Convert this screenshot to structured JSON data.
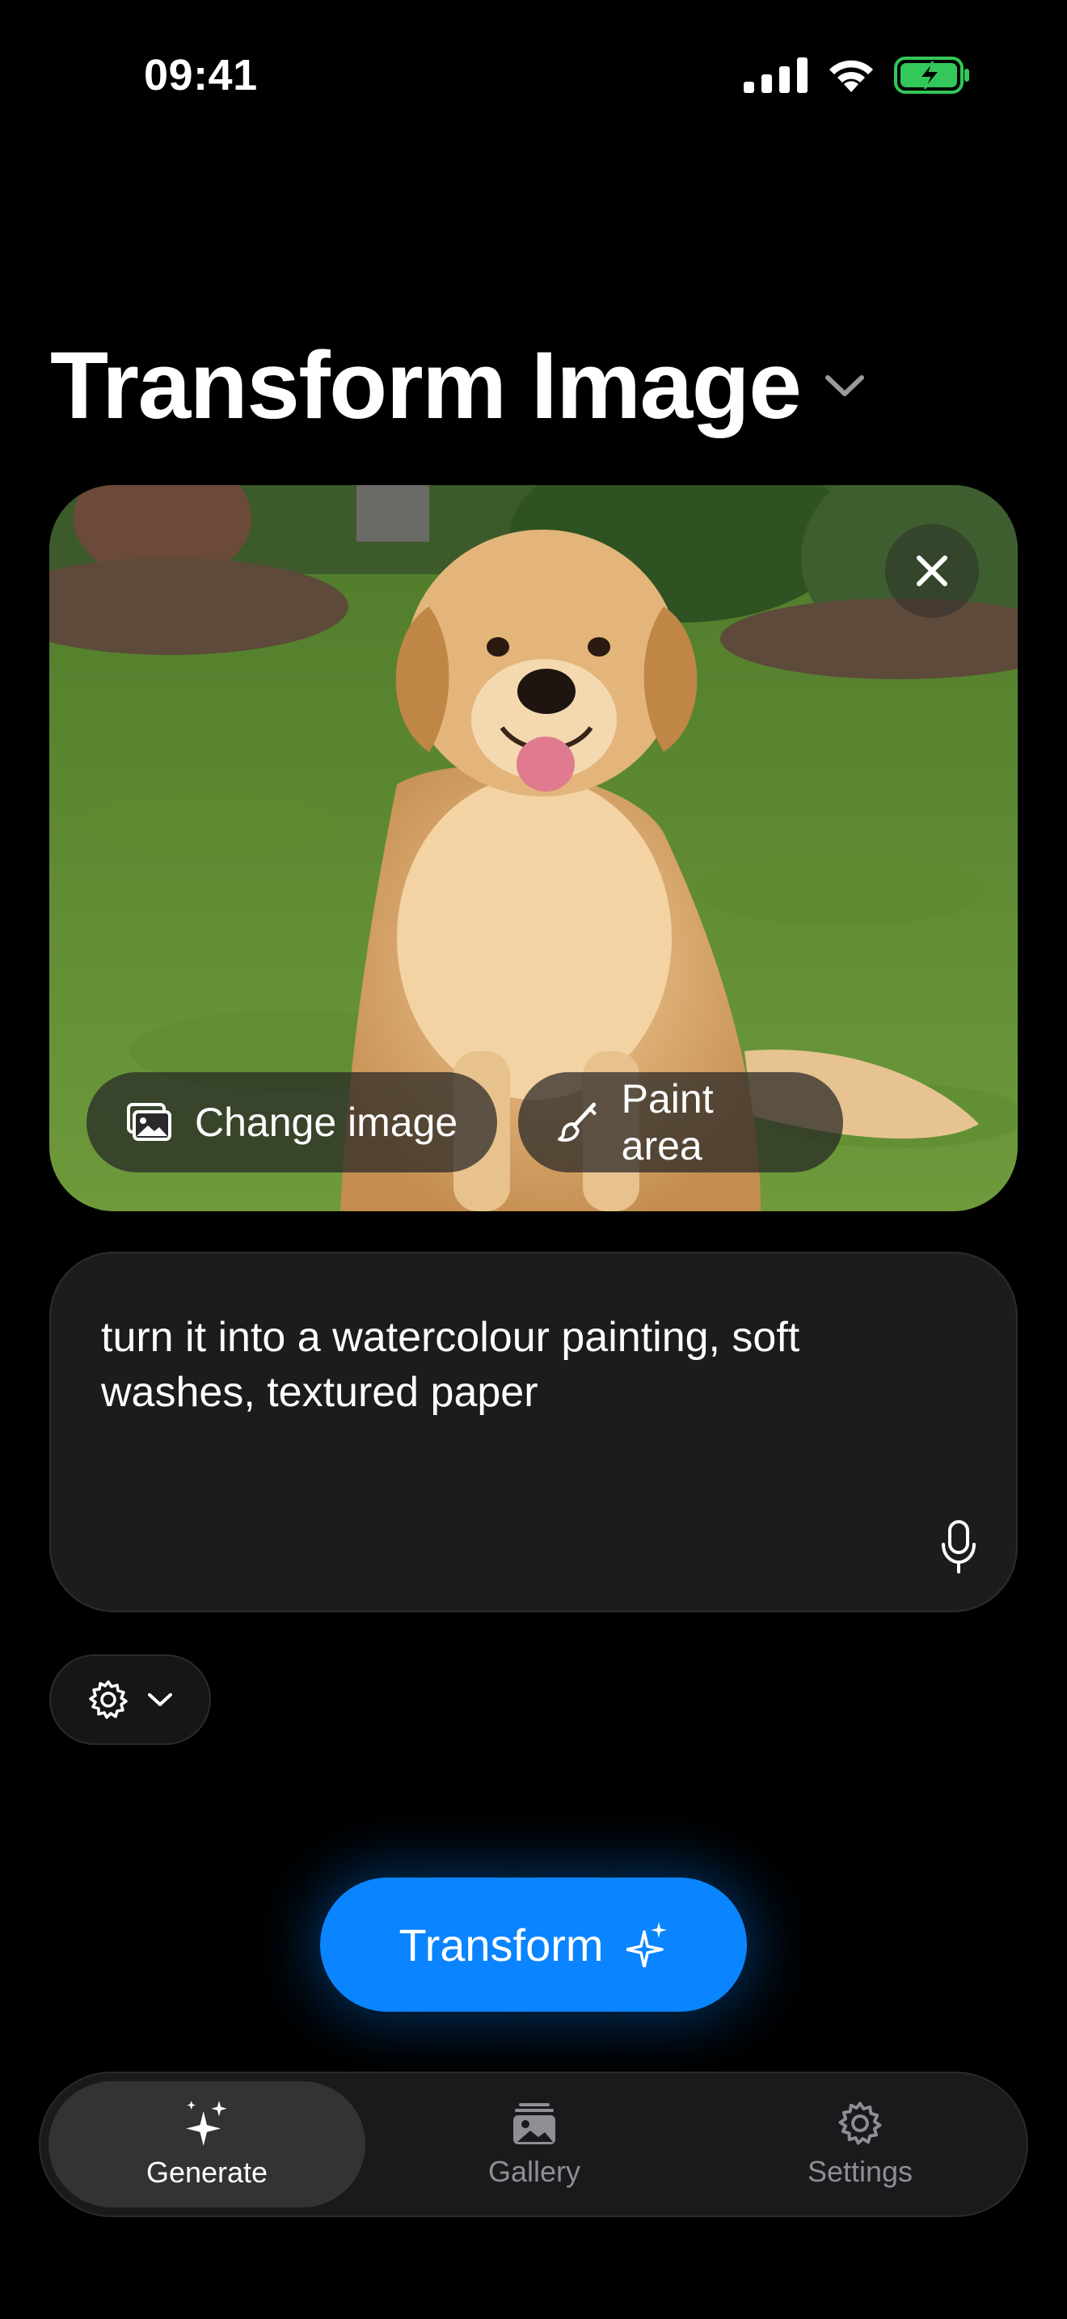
{
  "status_bar": {
    "time": "09:41"
  },
  "header": {
    "title": "Transform Image"
  },
  "image_card": {
    "change_image_label": "Change image",
    "paint_area_label": "Paint area"
  },
  "prompt": {
    "text": "turn it into a watercolour painting, soft washes, textured paper"
  },
  "actions": {
    "transform_label": "Transform"
  },
  "tabbar": {
    "tabs": [
      {
        "label": "Generate",
        "icon": "sparkles-icon",
        "active": true
      },
      {
        "label": "Gallery",
        "icon": "photo-stack-icon",
        "active": false
      },
      {
        "label": "Settings",
        "icon": "gear-icon",
        "active": false
      }
    ]
  },
  "colors": {
    "accent": "#0a84ff",
    "background": "#000000",
    "surface": "#1c1c1e",
    "battery": "#34c759"
  }
}
